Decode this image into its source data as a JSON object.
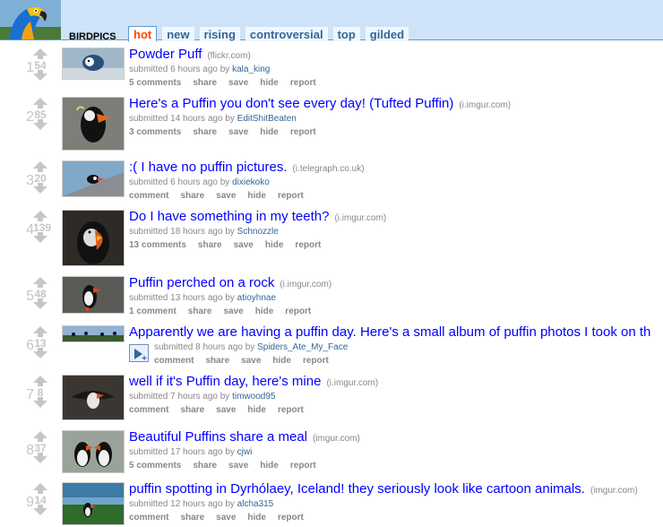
{
  "subreddit": {
    "name": "BIRDPICS"
  },
  "tabs": [
    {
      "label": "hot",
      "selected": true
    },
    {
      "label": "new",
      "selected": false
    },
    {
      "label": "rising",
      "selected": false
    },
    {
      "label": "controversial",
      "selected": false
    },
    {
      "label": "top",
      "selected": false
    },
    {
      "label": "gilded",
      "selected": false
    }
  ],
  "colors": {
    "header_bg": "#cee3f8",
    "link": "#0000ff",
    "tab_selected": "#ff4500",
    "author": "#369"
  },
  "posts": [
    {
      "rank": "1",
      "score": "54",
      "title": "Powder Puff",
      "domain": "(flickr.com)",
      "time": "6 hours ago",
      "author": "kala_king",
      "comments": "5 comments",
      "share": "share",
      "save": "save",
      "hide": "hide",
      "report": "report",
      "submitted": "submitted",
      "by": "by"
    },
    {
      "rank": "2",
      "score": "85",
      "title": "Here's a Puffin you don't see every day! (Tufted Puffin)",
      "domain": "(i.imgur.com)",
      "time": "14 hours ago",
      "author": "EditShitBeaten",
      "comments": "3 comments",
      "share": "share",
      "save": "save",
      "hide": "hide",
      "report": "report",
      "submitted": "submitted",
      "by": "by"
    },
    {
      "rank": "3",
      "score": "20",
      "title": ":( I have no puffin pictures.",
      "domain": "(i.telegraph.co.uk)",
      "time": "6 hours ago",
      "author": "dixiekoko",
      "comments": "comment",
      "share": "share",
      "save": "save",
      "hide": "hide",
      "report": "report",
      "submitted": "submitted",
      "by": "by"
    },
    {
      "rank": "4",
      "score": "139",
      "title": "Do I have something in my teeth?",
      "domain": "(i.imgur.com)",
      "time": "18 hours ago",
      "author": "Schnozzle",
      "comments": "13 comments",
      "share": "share",
      "save": "save",
      "hide": "hide",
      "report": "report",
      "submitted": "submitted",
      "by": "by"
    },
    {
      "rank": "5",
      "score": "48",
      "title": "Puffin perched on a rock",
      "domain": "(i.imgur.com)",
      "time": "13 hours ago",
      "author": "atioyhnae",
      "comments": "1 comment",
      "share": "share",
      "save": "save",
      "hide": "hide",
      "report": "report",
      "submitted": "submitted",
      "by": "by"
    },
    {
      "rank": "6",
      "score": "13",
      "title": "Apparently we are having a puffin day. Here's a small album of puffin photos I took on th",
      "domain": "",
      "time": "8 hours ago",
      "author": "Spiders_Ate_My_Face",
      "comments": "comment",
      "share": "share",
      "save": "save",
      "hide": "hide",
      "report": "report",
      "submitted": "submitted",
      "by": "by"
    },
    {
      "rank": "7",
      "score": "8",
      "title": "well if it's Puffin day, here's mine",
      "domain": "(i.imgur.com)",
      "time": "7 hours ago",
      "author": "timwood95",
      "comments": "comment",
      "share": "share",
      "save": "save",
      "hide": "hide",
      "report": "report",
      "submitted": "submitted",
      "by": "by"
    },
    {
      "rank": "8",
      "score": "37",
      "title": "Beautiful Puffins share a meal",
      "domain": "(imgur.com)",
      "time": "17 hours ago",
      "author": "cjwi",
      "comments": "5 comments",
      "share": "share",
      "save": "save",
      "hide": "hide",
      "report": "report",
      "submitted": "submitted",
      "by": "by"
    },
    {
      "rank": "9",
      "score": "14",
      "title": "puffin spotting in Dyrhólaey, Iceland! they seriously look like cartoon animals.",
      "domain": "(imgur.com)",
      "time": "12 hours ago",
      "author": "alcha315",
      "comments": "comment",
      "share": "share",
      "save": "save",
      "hide": "hide",
      "report": "report",
      "submitted": "submitted",
      "by": "by"
    }
  ]
}
